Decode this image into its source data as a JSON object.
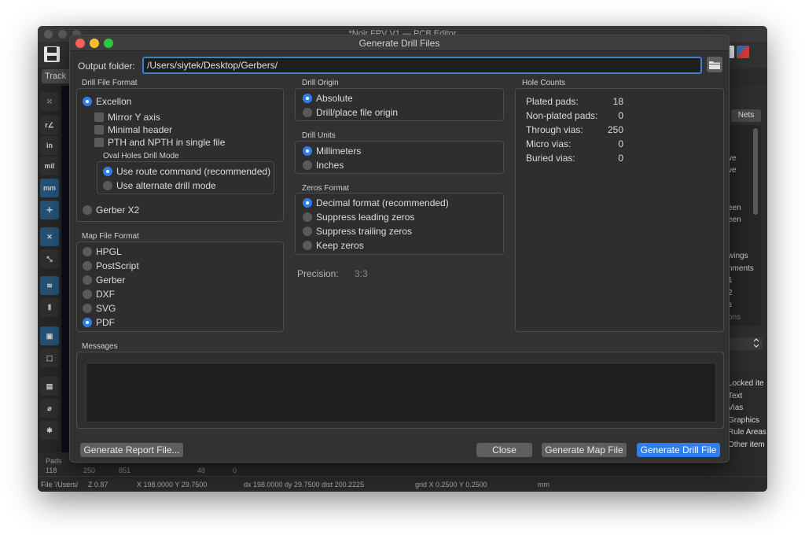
{
  "background_window": {
    "title": "*Noir FPV V1 — PCB Editor",
    "track_button": "Track",
    "nets_tab": "Nets",
    "right_panel_items": [
      "ve",
      "ve",
      "een",
      "een",
      "wings",
      "nments",
      "1",
      "2",
      "s",
      "ons"
    ],
    "selection_filter_items": [
      "Locked ite",
      "Text",
      "Vias",
      "Graphics",
      "Rule Areas",
      "Other item"
    ],
    "left_toolbar_labels": [
      "in",
      "mil",
      "mm"
    ],
    "message_panel": {
      "pads_label": "Pads",
      "values": [
        "118",
        "250",
        "851",
        "48",
        "0"
      ]
    },
    "status_bar": {
      "file": "File '/Users/",
      "zoom": "Z 0.87",
      "xy": "X 198.0000  Y 29.7500",
      "dxdy": "dx 198.0000  dy 29.7500  dist 200.2225",
      "grid": "grid X 0.2500  Y 0.2500",
      "units": "mm"
    }
  },
  "dialog": {
    "title": "Generate Drill Files",
    "output_folder": {
      "label": "Output folder:",
      "value": "/Users/siytek/Desktop/Gerbers/"
    },
    "drill_file_format": {
      "title": "Drill File Format",
      "excellon": "Excellon",
      "options": [
        "Mirror Y axis",
        "Minimal header",
        "PTH and NPTH in single file"
      ],
      "oval_holes_title": "Oval Holes Drill Mode",
      "oval_options": [
        "Use route command (recommended)",
        "Use alternate drill mode"
      ],
      "gerber_x2": "Gerber X2"
    },
    "map_file_format": {
      "title": "Map File Format",
      "options": [
        "HPGL",
        "PostScript",
        "Gerber",
        "DXF",
        "SVG",
        "PDF"
      ],
      "selected": 5
    },
    "drill_origin": {
      "title": "Drill Origin",
      "options": [
        "Absolute",
        "Drill/place file origin"
      ],
      "selected": 0
    },
    "drill_units": {
      "title": "Drill Units",
      "options": [
        "Millimeters",
        "Inches"
      ],
      "selected": 0
    },
    "zeros_format": {
      "title": "Zeros Format",
      "options": [
        "Decimal format (recommended)",
        "Suppress leading zeros",
        "Suppress trailing zeros",
        "Keep zeros"
      ],
      "selected": 0
    },
    "precision": {
      "label": "Precision:",
      "value": "3:3"
    },
    "hole_counts": {
      "title": "Hole Counts",
      "rows": [
        {
          "label": "Plated pads:",
          "value": "18"
        },
        {
          "label": "Non-plated pads:",
          "value": "0"
        },
        {
          "label": "Through vias:",
          "value": "250"
        },
        {
          "label": "Micro vias:",
          "value": "0"
        },
        {
          "label": "Buried vias:",
          "value": "0"
        }
      ]
    },
    "messages_title": "Messages",
    "buttons": {
      "report": "Generate Report File...",
      "close": "Close",
      "map": "Generate Map File",
      "drill": "Generate Drill File"
    }
  },
  "colors": {
    "accent": "#2f7ef0",
    "dialog_bg": "#323232",
    "focus_border": "#3f7fd3"
  }
}
